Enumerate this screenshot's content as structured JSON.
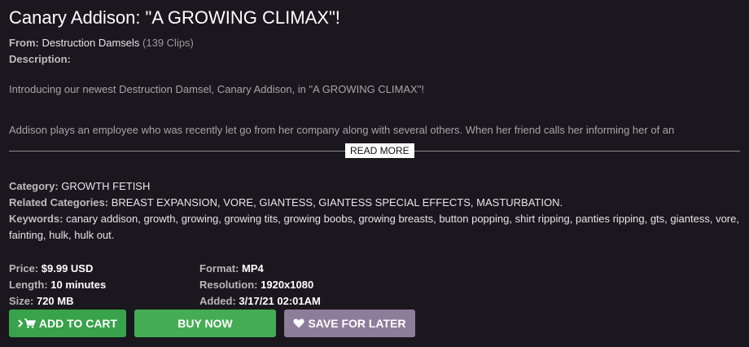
{
  "clip": {
    "title": "Canary Addison: \"A GROWING CLIMAX\"!",
    "from_label": "From:",
    "studio": "Destruction Damsels",
    "clip_count": "(139 Clips)",
    "description_label": "Description:",
    "description_p1": "Introducing our newest Destruction Damsel, Canary Addison, in \"A GROWING CLIMAX\"!",
    "description_p2": "Addison plays an employee who was recently let go from her company along with several others. When her friend calls her informing her of an",
    "read_more": "READ MORE",
    "category_label": "Category:",
    "category": "GROWTH FETISH",
    "related_label": "Related Categories:",
    "related": [
      "BREAST EXPANSION",
      "VORE",
      "GIANTESS",
      "GIANTESS SPECIAL EFFECTS",
      "MASTURBATION"
    ],
    "keywords_label": "Keywords:",
    "keywords": [
      "canary addison",
      "growth",
      "growing",
      "growing tits",
      "growing boobs",
      "growing breasts",
      "button popping",
      "shirt ripping",
      "panties ripping",
      "gts",
      "giantess",
      "vore",
      "fainting",
      "hulk",
      "hulk out"
    ]
  },
  "details": {
    "price_label": "Price:",
    "price": "$9.99 USD",
    "length_label": "Length:",
    "length": "10 minutes",
    "size_label": "Size:",
    "size": "720 MB",
    "format_label": "Format:",
    "format": "MP4",
    "resolution_label": "Resolution:",
    "resolution": "1920x1080",
    "added_label": "Added:",
    "added": "3/17/21 02:01AM"
  },
  "buttons": {
    "add_to_cart": "ADD TO CART",
    "add_to_cart_icon": "cart-icon",
    "buy_now": "BUY NOW",
    "save_for_later": "SAVE FOR LATER",
    "save_icon": "heart-icon"
  },
  "colors": {
    "background": "#1a171e",
    "add_to_cart": "#38a34a",
    "buy_now": "#44ac54",
    "save_for_later": "#8e7d9a"
  }
}
